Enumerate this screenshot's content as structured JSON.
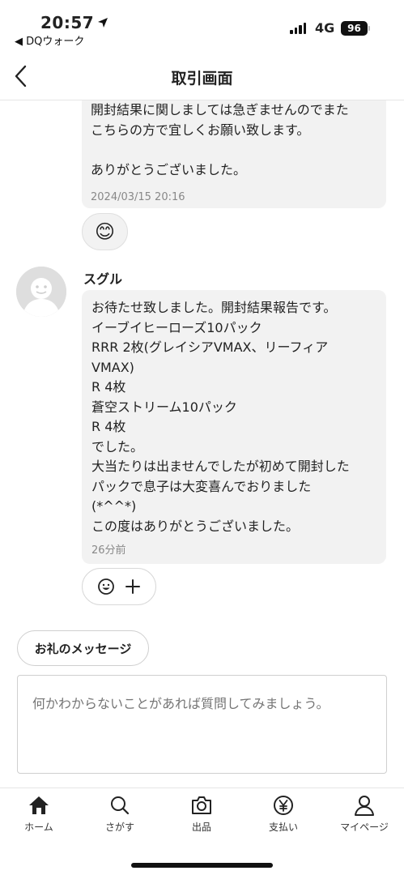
{
  "status_bar": {
    "time": "20:57",
    "back_app": "◀ DQウォーク",
    "network": "4G",
    "battery": "96"
  },
  "header": {
    "title": "取引画面"
  },
  "messages": {
    "previous": {
      "text": "開封結果に関しましては急ぎませんのでまた\nこちらの方で宜しくお願い致します。\n\nありがとうございました。",
      "time": "2024/03/15 20:16",
      "reaction": "😊"
    },
    "latest": {
      "sender": "スグル",
      "text": "お待たせ致しました。開封結果報告です。\nイーブイヒーローズ10パック\nRRR 2枚(グレイシアVMAX、リーフィア\nVMAX)\nR 4枚\n蒼空ストリーム10パック\nR 4枚\nでした。\n大当たりは出ませんでしたが初めて開封した\nパックで息子は大変喜んでおりました\n(*^^*)\nこの度はありがとうございました。",
      "time": "26分前"
    }
  },
  "actions": {
    "thanks_button": "お礼のメッセージ",
    "input_placeholder": "何かわからないことがあれば質問してみましょう。"
  },
  "tab_bar": {
    "items": [
      {
        "label": "ホーム",
        "icon": "home-icon"
      },
      {
        "label": "さがす",
        "icon": "search-icon"
      },
      {
        "label": "出品",
        "icon": "camera-icon"
      },
      {
        "label": "支払い",
        "icon": "yen-icon"
      },
      {
        "label": "マイページ",
        "icon": "person-icon"
      }
    ]
  },
  "colors": {
    "bubble": "#f2f2f2",
    "text": "#222222",
    "muted": "#888888"
  }
}
